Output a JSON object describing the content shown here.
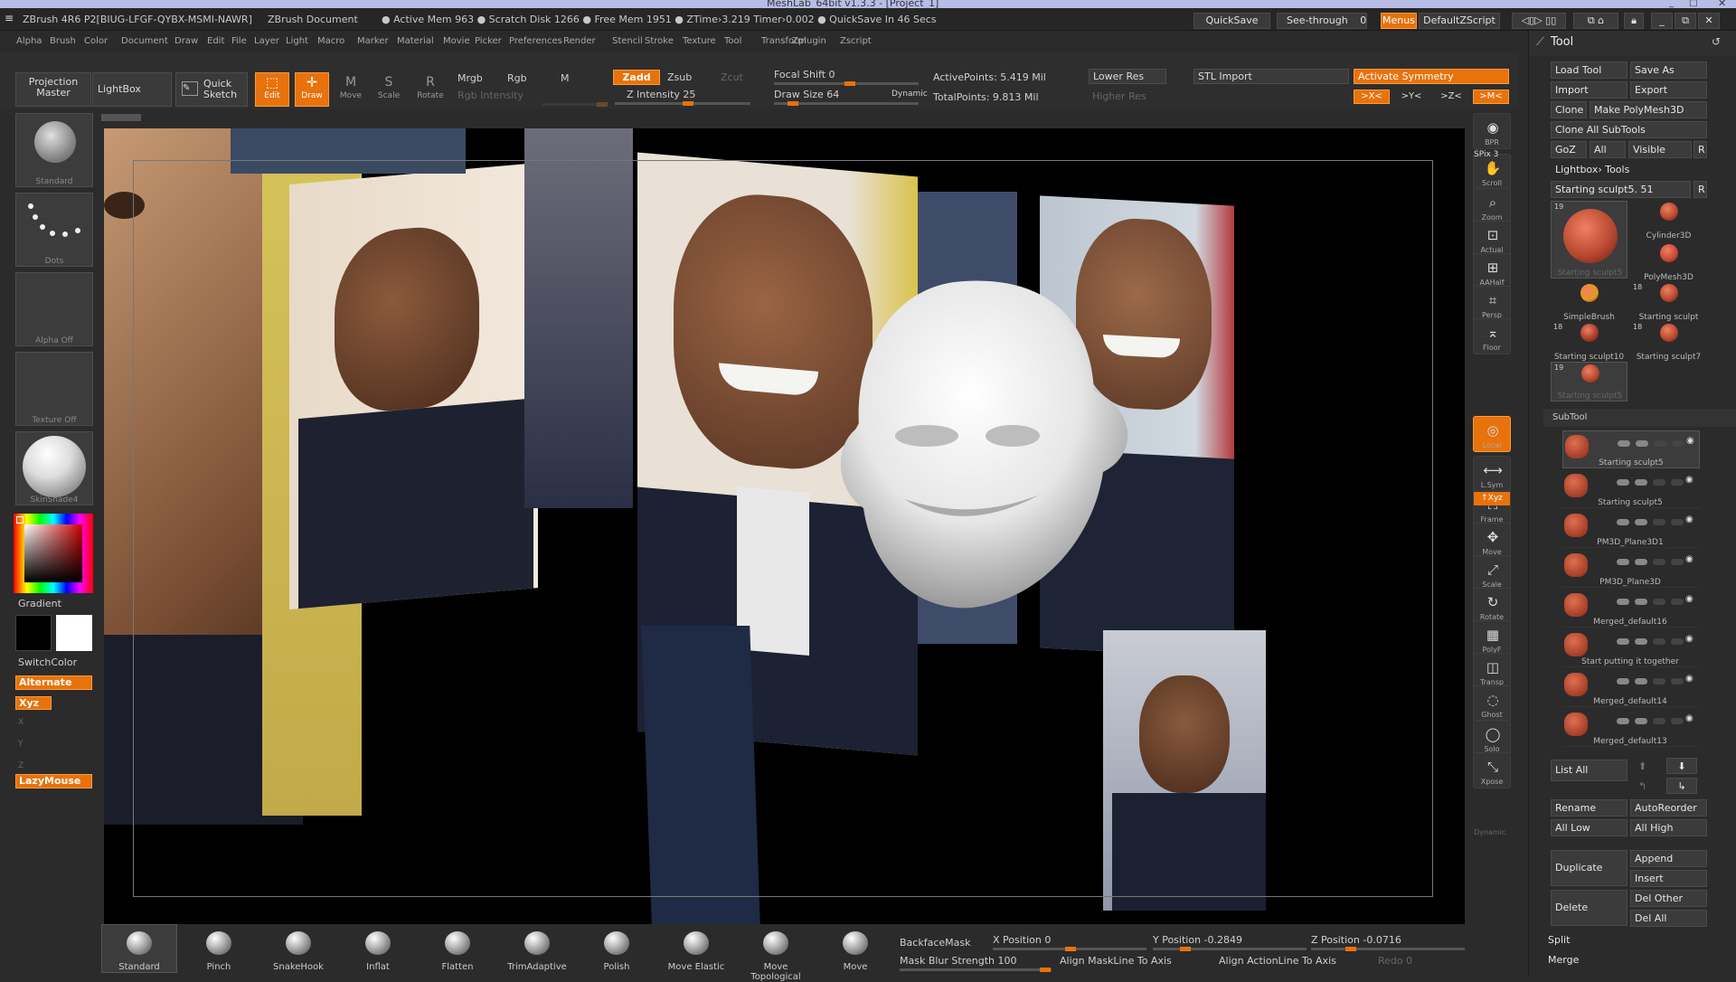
{
  "window": {
    "title": "MeshLab_64bit v1.3.3 - [Project_1]"
  },
  "infobar": {
    "app": "ZBrush 4R6 P2[BIUG-LFGF-QYBX-MSMI-NAWR]",
    "doc": "ZBrush Document",
    "stats": "● Active Mem 963 ● Scratch Disk 1266 ● Free Mem 1951 ● ZTime›3.219 Timer›0.002 ● QuickSave In 46 Secs",
    "quicksave": "QuickSave",
    "seethrough": "See-through",
    "seethrough_value": "0",
    "menus": "Menus",
    "script": "DefaultZScript"
  },
  "menus": [
    "Alpha",
    "Brush",
    "Color",
    "Document",
    "Draw",
    "Edit",
    "File",
    "Layer",
    "Light",
    "Macro",
    "Marker",
    "Material",
    "Movie",
    "Picker",
    "Preferences",
    "Render",
    "Stencil",
    "Stroke",
    "Texture",
    "Tool",
    "Transform",
    "Zplugin",
    "Zscript"
  ],
  "shelf": {
    "projection_master": "Projection Master",
    "lightbox": "LightBox",
    "quick_sketch": "Quick Sketch",
    "edit": "Edit",
    "draw": "Draw",
    "move": "Move",
    "scale": "Scale",
    "rotate": "Rotate",
    "mrgb": "Mrgb",
    "rgb": "Rgb",
    "m": "M",
    "rgb_intensity": "Rgb Intensity",
    "zadd": "Zadd",
    "zsub": "Zsub",
    "zcut": "Zcut",
    "z_intensity": "Z Intensity 25",
    "focal_shift": "Focal Shift 0",
    "draw_size": "Draw Size 64",
    "dynamic": "Dynamic",
    "active_points": "ActivePoints: 5.419 Mil",
    "total_points": "TotalPoints: 9.813 Mil",
    "lower_res": "Lower Res",
    "higher_res": "Higher Res",
    "stl_import": "STL Import",
    "activate_symmetry": "Activate Symmetry",
    "sym_x": ">X<",
    "sym_y": ">Y<",
    "sym_z": ">Z<",
    "sym_m": ">M<"
  },
  "left": {
    "brush": "Standard",
    "stroke": "Dots",
    "alpha": "Alpha Off",
    "texture": "Texture Off",
    "material": "SkinShade4",
    "gradient": "Gradient",
    "switchcolor": "SwitchColor",
    "alternate": "Alternate",
    "xyz": "Xyz",
    "x": "X",
    "y": "Y",
    "z": "Z",
    "lazymouse": "LazyMouse"
  },
  "dock": [
    {
      "label": "BPR",
      "icon": "bpr-icon"
    },
    {
      "label": "Scroll",
      "icon": "scroll-icon"
    },
    {
      "label": "Zoom",
      "icon": "zoom-icon"
    },
    {
      "label": "Actual",
      "icon": "actual-icon"
    },
    {
      "label": "AAHalf",
      "icon": "aahalf-icon"
    },
    {
      "label": "Persp",
      "icon": "persp-icon"
    },
    {
      "label": "Floor",
      "icon": "floor-icon"
    },
    {
      "label": "Local",
      "icon": "local-icon"
    },
    {
      "label": "L.Sym",
      "icon": "lsym-icon"
    },
    {
      "label": "Frame",
      "icon": "frame-icon"
    },
    {
      "label": "Move",
      "icon": "move-icon"
    },
    {
      "label": "Scale",
      "icon": "scale-icon"
    },
    {
      "label": "Rotate",
      "icon": "rotate-icon"
    },
    {
      "label": "PolyF",
      "icon": "polyf-icon"
    },
    {
      "label": "Transp",
      "icon": "transp-icon"
    },
    {
      "label": "Ghost",
      "icon": "ghost-icon"
    },
    {
      "label": "Solo",
      "icon": "solo-icon"
    },
    {
      "label": "Xpose",
      "icon": "xpose-icon"
    }
  ],
  "dock_extra": {
    "spix": "SPix 3",
    "xyz": "↑Xyz",
    "dynamic": "Dynamic"
  },
  "tool": {
    "title": "Tool",
    "load_tool": "Load Tool",
    "save_as": "Save As",
    "import": "Import",
    "export": "Export",
    "clone": "Clone",
    "make_polymesh": "Make PolyMesh3D",
    "clone_all": "Clone All SubTools",
    "goz": "GoZ",
    "all": "All",
    "visible": "Visible",
    "r": "R",
    "lightbox_tools": "Lightbox› Tools",
    "current": "Starting sculpt5. 51",
    "tools": [
      {
        "name": "Starting sculpt5",
        "count": "19"
      },
      {
        "name": "Cylinder3D",
        "count": ""
      },
      {
        "name": "PolyMesh3D",
        "count": ""
      },
      {
        "name": "SimpleBrush",
        "count": ""
      },
      {
        "name": "Starting sculpt",
        "count": "18"
      },
      {
        "name": "Starting sculpt10",
        "count": "18"
      },
      {
        "name": "Starting sculpt7",
        "count": "18"
      },
      {
        "name": "Starting sculpt5",
        "count": "19"
      }
    ],
    "subtool_title": "SubTool",
    "subtools": [
      "Starting sculpt5",
      "Starting sculpt5",
      "PM3D_Plane3D1",
      "PM3D_Plane3D",
      "Merged_default16",
      "Start putting it together",
      "Merged_default14",
      "Merged_default13"
    ],
    "list_all": "List All",
    "rename": "Rename",
    "autoreorder": "AutoReorder",
    "all_low": "All Low",
    "all_high": "All High",
    "duplicate": "Duplicate",
    "append": "Append",
    "insert": "Insert",
    "delete": "Delete",
    "del_other": "Del Other",
    "del_all": "Del All",
    "split": "Split",
    "merge": "Merge"
  },
  "bottom": {
    "brushes": [
      "Standard",
      "Pinch",
      "SnakeHook",
      "Inflat",
      "Flatten",
      "TrimAdaptive",
      "Polish",
      "Move Elastic",
      "Move Topological",
      "Move"
    ],
    "backfacemask": "BackfaceMask",
    "mask_blur": "Mask Blur Strength 100",
    "x_position": "X Position 0",
    "y_position": "Y Position -0.2849",
    "z_position": "Z Position -0.0716",
    "align_maskline": "Align MaskLine To Axis",
    "align_actionline": "Align ActionLine To Axis",
    "redo": "Redo 0"
  },
  "colors": {
    "accent": "#e8720c",
    "panel": "#2b2b2b",
    "button": "#3b3b3b"
  }
}
